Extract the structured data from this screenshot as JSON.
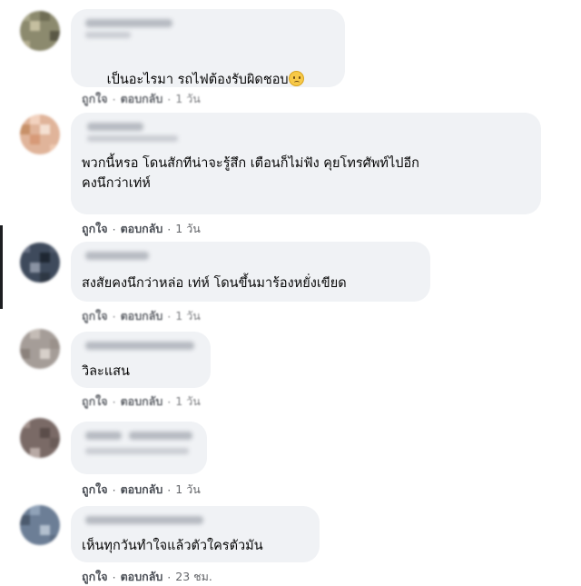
{
  "comments": [
    {
      "text": "เป็นอะไรมา รถไฟต้องรับผิดชอบ",
      "has_emoji": true,
      "emoji_name": "sad-face-icon",
      "like": "ถูกใจ",
      "reply": "ตอบกลับ",
      "time": "1 วัน"
    },
    {
      "text": "พวกนี้หรอ โดนสักทีน่าจะรู้สึก เตือนก็ไม่ฟัง คุยโทรศัพท์ไปอีก\nคงนึกว่าเท่ห์",
      "like": "ถูกใจ",
      "reply": "ตอบกลับ",
      "time": "1 วัน"
    },
    {
      "text": "สงสัยคงนึกว่าหล่อ เท่ห์ โดนขึ้นมาร้องหยั่งเขียด",
      "like": "ถูกใจ",
      "reply": "ตอบกลับ",
      "time": "1 วัน"
    },
    {
      "text": "วิละแสน",
      "like": "ถูกใจ",
      "reply": "ตอบกลับ",
      "time": "1 วัน"
    },
    {
      "text": "",
      "like": "ถูกใจ",
      "reply": "ตอบกลับ",
      "time": "1 วัน"
    },
    {
      "text": "เห็นทุกวันทำใจแล้วตัวใครตัวมัน",
      "like": "ถูกใจ",
      "reply": "ตอบกลับ",
      "time": "23 ชม."
    }
  ],
  "colors": {
    "bubble_bg": "#f0f2f5",
    "text": "#050505",
    "meta": "#65676b"
  }
}
